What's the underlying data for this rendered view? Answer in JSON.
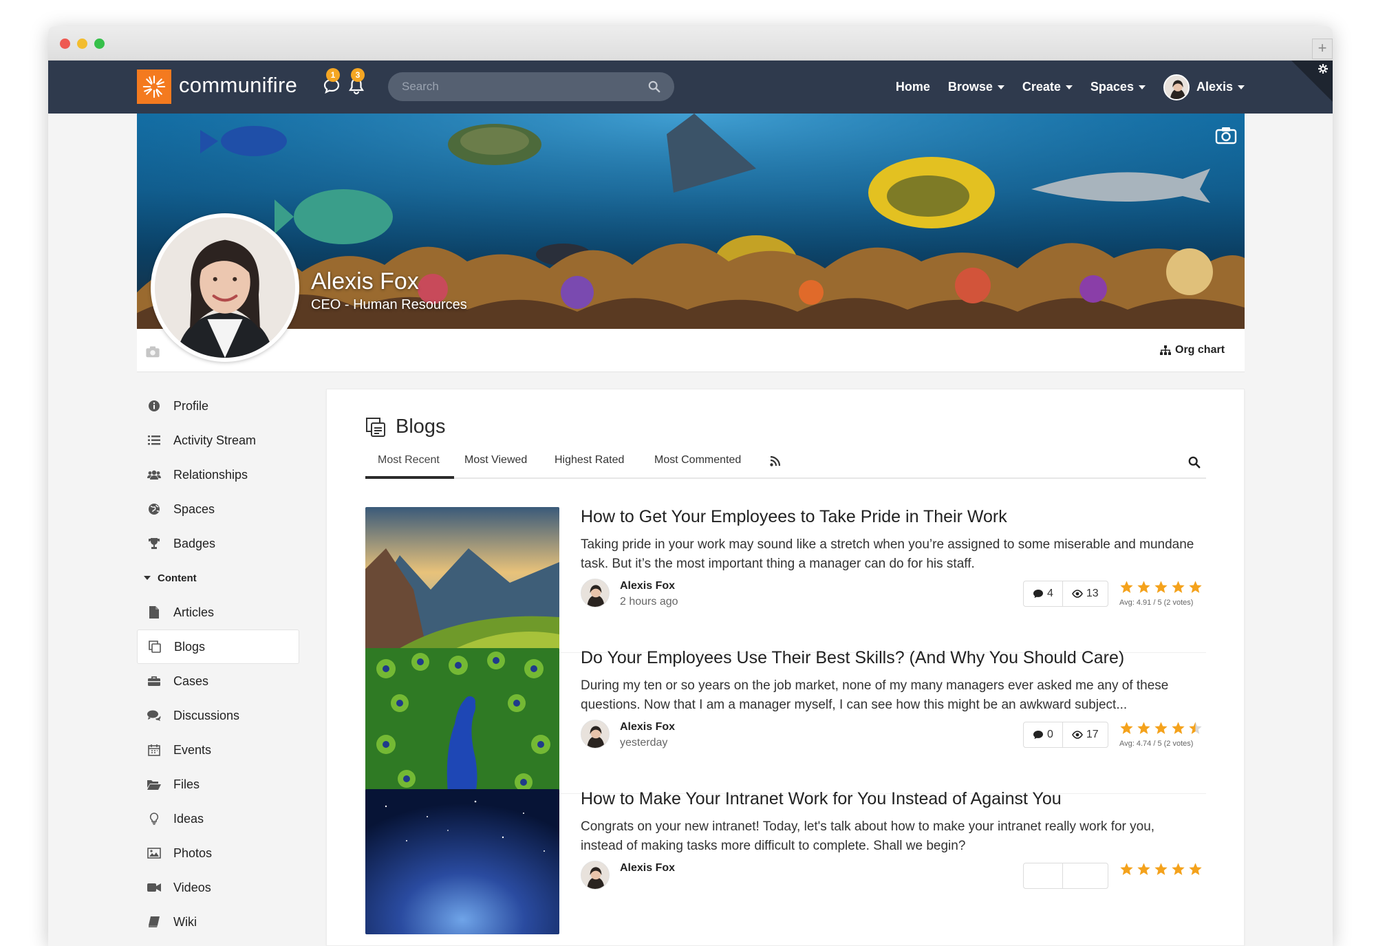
{
  "nav": {
    "logo_text": "communifire",
    "chat_count": "1",
    "notif_count": "3",
    "search_placeholder": "Search",
    "links": [
      "Home",
      "Browse",
      "Create",
      "Spaces"
    ],
    "user_name": "Alexis"
  },
  "profile": {
    "name": "Alexis Fox",
    "title": "CEO - Human Resources",
    "org_chart": "Org chart"
  },
  "sidebar": {
    "items_top": [
      "Profile",
      "Activity Stream",
      "Relationships",
      "Spaces",
      "Badges"
    ],
    "section": "Content",
    "items_content": [
      "Articles",
      "Blogs",
      "Cases",
      "Discussions",
      "Events",
      "Files",
      "Ideas",
      "Photos",
      "Videos",
      "Wiki"
    ],
    "active": "Blogs"
  },
  "main": {
    "title": "Blogs",
    "tabs": [
      "Most Recent",
      "Most Viewed",
      "Highest Rated",
      "Most Commented"
    ],
    "active_tab": "Most Recent"
  },
  "posts": [
    {
      "title": "How to Get Your Employees to Take Pride in Their Work",
      "excerpt": "Taking pride in your work may sound like a stretch when you’re assigned to some miserable and mundane task. But it’s the most important thing a manager can do for his staff.",
      "author": "Alexis Fox",
      "time": "2 hours ago",
      "comments": "4",
      "views": "13",
      "rating": 4.91,
      "avg_text": "Avg: 4.91 / 5 (2 votes)"
    },
    {
      "title": "Do Your Employees Use Their Best Skills? (And Why You Should Care)",
      "excerpt": "During my ten or so years on the job market, none of my many managers ever asked me any of these questions. Now that I am a manager myself, I can see how this might be an awkward subject...",
      "author": "Alexis Fox",
      "time": "yesterday",
      "comments": "0",
      "views": "17",
      "rating": 4.74,
      "avg_text": "Avg: 4.74 / 5 (2 votes)"
    },
    {
      "title": "How to Make Your Intranet Work for You Instead of Against You",
      "excerpt": "Congrats on your new intranet! Today, let's talk about how to make your intranet really work for you, instead of making tasks more difficult to complete. Shall we begin?",
      "author": "Alexis Fox",
      "time": "",
      "comments": "",
      "views": "",
      "rating": 5,
      "avg_text": ""
    }
  ],
  "colors": {
    "nav_bg": "#2f3a4d",
    "brand_orange": "#f47a1f",
    "badge": "#f5a623",
    "star": "#f4a21c"
  }
}
